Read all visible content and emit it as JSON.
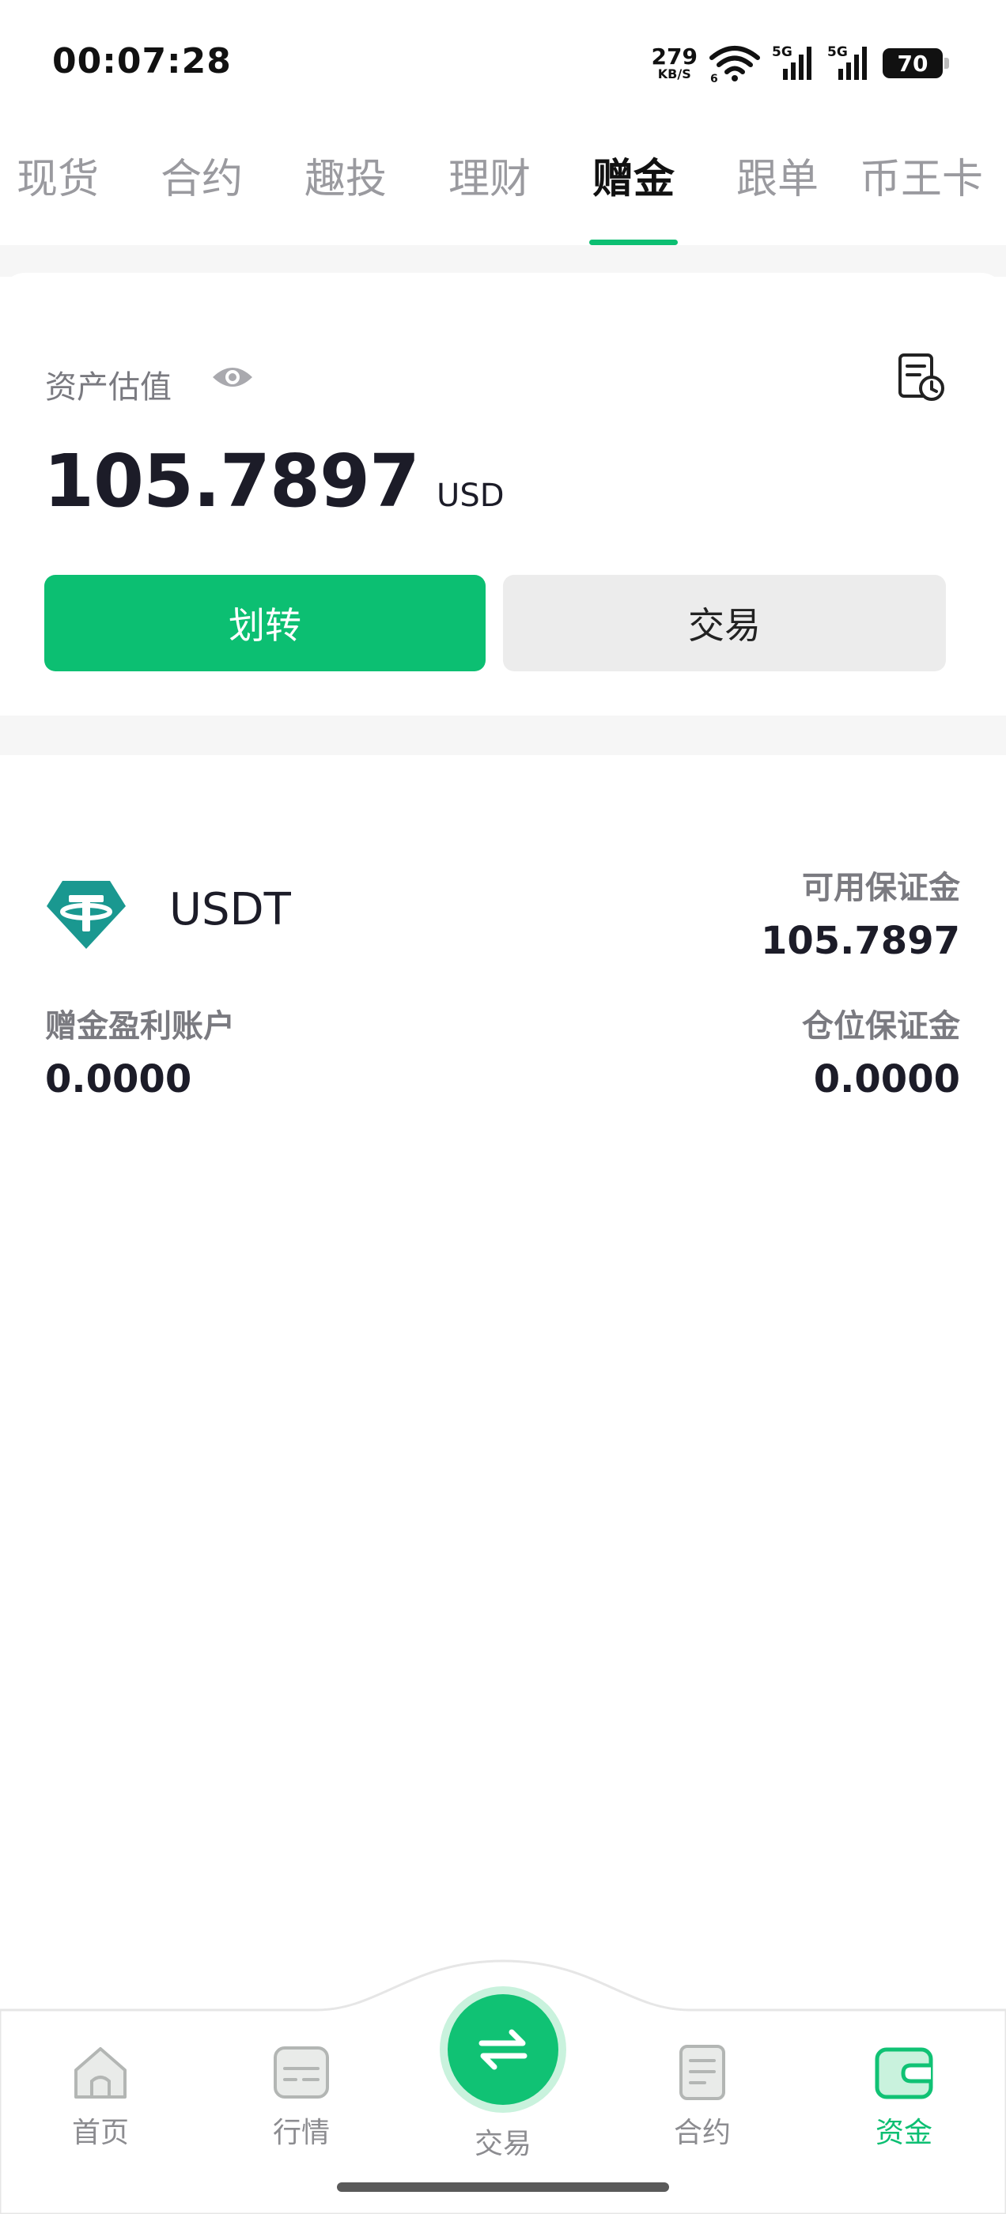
{
  "status_bar": {
    "time": "00:07:28",
    "net_speed": "279",
    "net_unit": "KB/S",
    "wifi_sub": "6",
    "signal1_label": "5G",
    "signal2_label": "5G",
    "battery": "70"
  },
  "tabs": [
    {
      "label": "现货",
      "active": false
    },
    {
      "label": "合约",
      "active": false
    },
    {
      "label": "趣投",
      "active": false
    },
    {
      "label": "理财",
      "active": false
    },
    {
      "label": "赠金",
      "active": true
    },
    {
      "label": "跟单",
      "active": false
    },
    {
      "label": "币王卡",
      "active": false
    }
  ],
  "asset": {
    "label": "资产估值",
    "value": "105.7897",
    "currency": "USD",
    "transfer_label": "划转",
    "trade_label": "交易"
  },
  "account": {
    "coin": "USDT",
    "available_label": "可用保证金",
    "available_value": "105.7897",
    "profit_label": "赠金盈利账户",
    "profit_value": "0.0000",
    "position_label": "仓位保证金",
    "position_value": "0.0000"
  },
  "nav": {
    "home": "首页",
    "market": "行情",
    "trade": "交易",
    "contract": "合约",
    "assets": "资金"
  },
  "colors": {
    "accent": "#0cbf72",
    "tether": "#1a9890"
  }
}
